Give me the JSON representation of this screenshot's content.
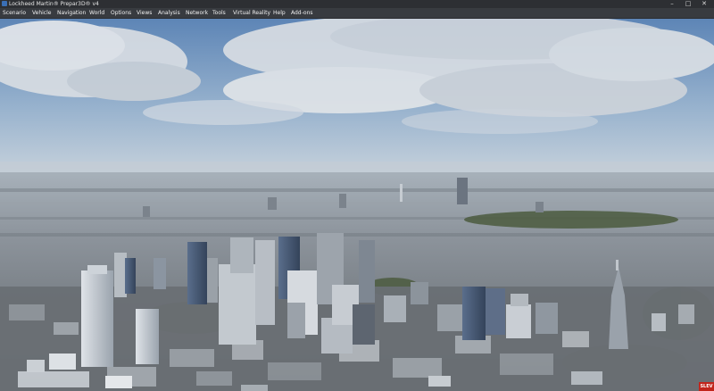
{
  "window": {
    "title": "Lockheed Martin® Prepar3D® v4",
    "minimize_glyph": "–",
    "maximize_glyph": "□",
    "close_glyph": "✕"
  },
  "menu": {
    "items": [
      "Scenario",
      "Vehicle",
      "Navigation",
      "World",
      "Options",
      "Views",
      "Analysis",
      "Network",
      "Tools",
      "Virtual Reality",
      "Help",
      "Add-ons"
    ]
  },
  "status": {
    "badge_text": "SLEV",
    "badge_color": "#c2241b"
  },
  "scene": {
    "sky_top": "#5d85b6",
    "sky_horizon": "#c7d2dc",
    "city_color": "#8c939b"
  }
}
